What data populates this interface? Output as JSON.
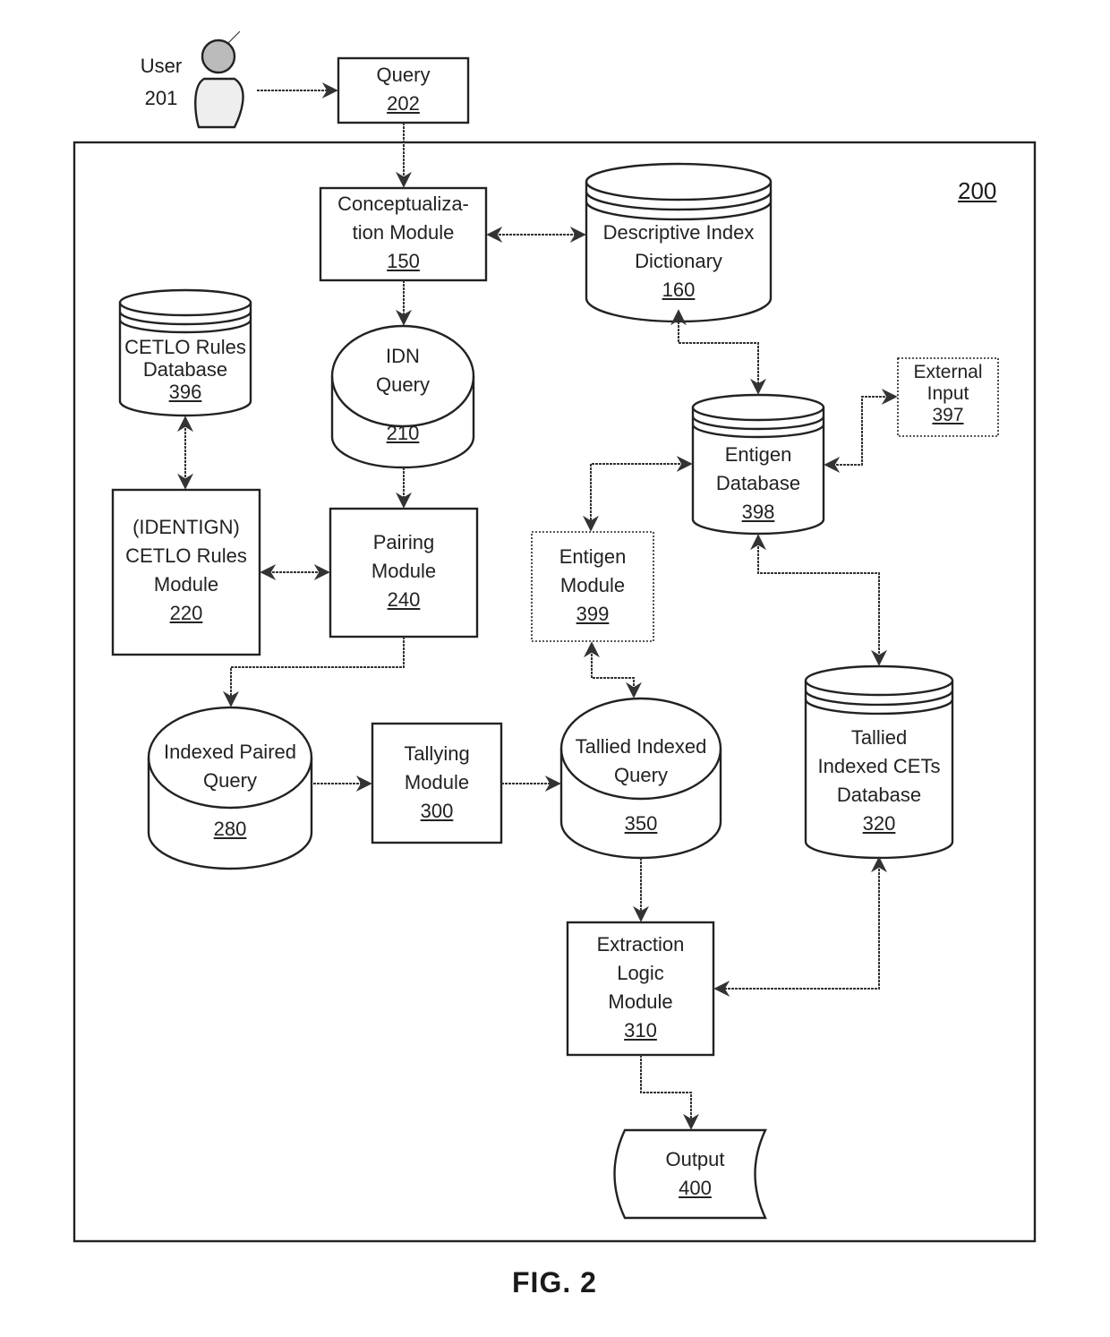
{
  "figure": {
    "caption": "FIG. 2",
    "system_ref": "200"
  },
  "user": {
    "label": "User",
    "ref": "201"
  },
  "nodes": {
    "query": {
      "lines": [
        "Query"
      ],
      "ref": "202"
    },
    "conceptualization": {
      "lines": [
        "Conceptualiza-",
        "tion Module"
      ],
      "ref": "150"
    },
    "descriptive_index": {
      "lines": [
        "Descriptive Index",
        "Dictionary"
      ],
      "ref": "160"
    },
    "cetlo_db": {
      "lines": [
        "CETLO Rules",
        "Database"
      ],
      "ref": "396"
    },
    "idn_query": {
      "lines": [
        "IDN",
        "Query"
      ],
      "ref": "210"
    },
    "external_input": {
      "lines": [
        "External",
        "Input"
      ],
      "ref": "397"
    },
    "entigen_db": {
      "lines": [
        "Entigen",
        "Database"
      ],
      "ref": "398"
    },
    "cetlo_module": {
      "lines": [
        "(IDENTIGN)",
        "CETLO Rules",
        "Module"
      ],
      "ref": "220"
    },
    "pairing": {
      "lines": [
        "Pairing",
        "Module"
      ],
      "ref": "240"
    },
    "entigen_module": {
      "lines": [
        "Entigen",
        "Module"
      ],
      "ref": "399"
    },
    "indexed_paired": {
      "lines": [
        "Indexed Paired",
        "Query"
      ],
      "ref": "280"
    },
    "tallying": {
      "lines": [
        "Tallying",
        "Module"
      ],
      "ref": "300"
    },
    "tallied_indexed_query": {
      "lines": [
        "Tallied Indexed",
        "Query"
      ],
      "ref": "350"
    },
    "tallied_cets_db": {
      "lines": [
        "Tallied",
        "Indexed CETs",
        "Database"
      ],
      "ref": "320"
    },
    "extraction": {
      "lines": [
        "Extraction",
        "Logic",
        "Module"
      ],
      "ref": "310"
    },
    "output": {
      "lines": [
        "Output"
      ],
      "ref": "400"
    }
  },
  "edges": [
    {
      "from": "user",
      "to": "query",
      "dir": "forward"
    },
    {
      "from": "query",
      "to": "conceptualization",
      "dir": "forward"
    },
    {
      "from": "conceptualization",
      "to": "descriptive_index",
      "dir": "both"
    },
    {
      "from": "conceptualization",
      "to": "idn_query",
      "dir": "forward"
    },
    {
      "from": "descriptive_index",
      "to": "entigen_db",
      "dir": "both"
    },
    {
      "from": "cetlo_db",
      "to": "cetlo_module",
      "dir": "both"
    },
    {
      "from": "idn_query",
      "to": "pairing",
      "dir": "forward"
    },
    {
      "from": "cetlo_module",
      "to": "pairing",
      "dir": "both"
    },
    {
      "from": "external_input",
      "to": "entigen_db",
      "dir": "both"
    },
    {
      "from": "entigen_db",
      "to": "entigen_module",
      "dir": "both"
    },
    {
      "from": "pairing",
      "to": "indexed_paired",
      "dir": "forward"
    },
    {
      "from": "indexed_paired",
      "to": "tallying",
      "dir": "forward"
    },
    {
      "from": "tallying",
      "to": "tallied_indexed_query",
      "dir": "forward"
    },
    {
      "from": "entigen_module",
      "to": "tallied_indexed_query",
      "dir": "both"
    },
    {
      "from": "entigen_db",
      "to": "tallied_cets_db",
      "dir": "both"
    },
    {
      "from": "tallied_indexed_query",
      "to": "extraction",
      "dir": "forward"
    },
    {
      "from": "tallied_cets_db",
      "to": "extraction",
      "dir": "both"
    },
    {
      "from": "extraction",
      "to": "output",
      "dir": "forward"
    }
  ]
}
